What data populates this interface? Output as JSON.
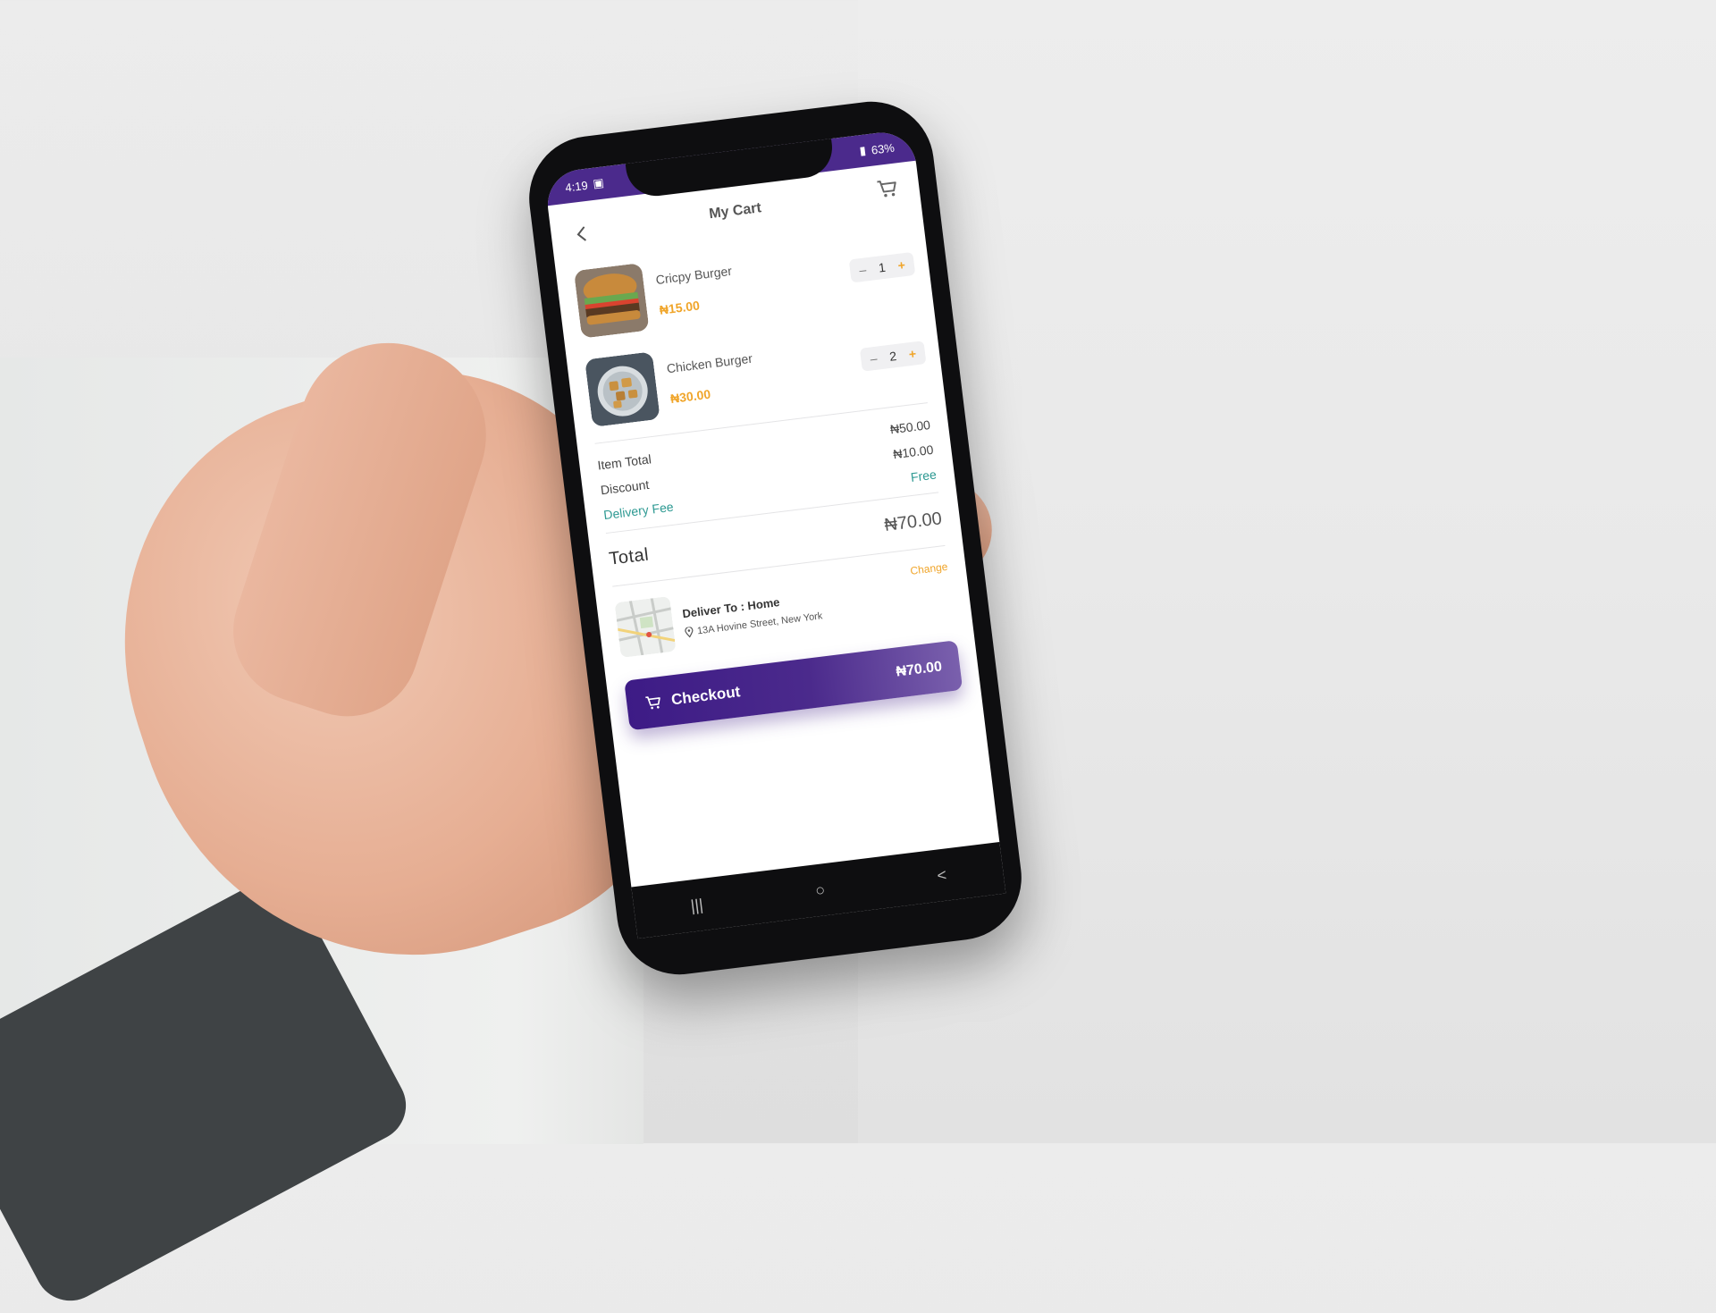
{
  "status": {
    "time": "4:19",
    "battery": "63%"
  },
  "header": {
    "title": "My Cart"
  },
  "items": [
    {
      "name": "Cricpy Burger",
      "price": "₦15.00",
      "qty": "1"
    },
    {
      "name": "Chicken Burger",
      "price": "₦30.00",
      "qty": "2"
    }
  ],
  "stepper": {
    "minus": "–",
    "plus": "+"
  },
  "summary": {
    "item_total_label": "Item Total",
    "item_total_value": "₦50.00",
    "discount_label": "Discount",
    "discount_value": "₦10.00",
    "delivery_label": "Delivery Fee",
    "delivery_value": "Free"
  },
  "total": {
    "label": "Total",
    "value": "₦70.00"
  },
  "delivery": {
    "title": "Deliver To : Home",
    "address": "13A Hovine Street, New York",
    "change": "Change"
  },
  "checkout": {
    "label": "Checkout",
    "amount": "₦70.00"
  },
  "colors": {
    "brand_purple": "#4b2a8c",
    "price_orange": "#f0a52a",
    "accent_teal": "#2f9a93"
  }
}
